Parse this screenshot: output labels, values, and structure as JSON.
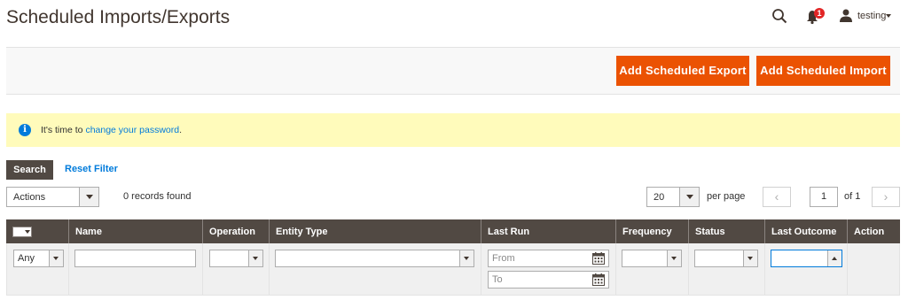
{
  "page": {
    "title": "Scheduled Imports/Exports"
  },
  "header": {
    "notifications_count": "1",
    "user_name": "testing"
  },
  "actions": {
    "add_export": "Add Scheduled Export",
    "add_import": "Add Scheduled Import"
  },
  "notice": {
    "prefix": "It's time to ",
    "link": "change your password",
    "suffix": "."
  },
  "grid_controls": {
    "search_label": "Search",
    "reset_label": "Reset Filter",
    "actions_select": "Actions",
    "records_found": "0 records found",
    "per_page_value": "20",
    "per_page_label": "per page",
    "page_current": "1",
    "page_total": "of 1",
    "prev_label": "‹",
    "next_label": "›"
  },
  "columns": {
    "name": "Name",
    "operation": "Operation",
    "entity_type": "Entity Type",
    "last_run": "Last Run",
    "frequency": "Frequency",
    "status": "Status",
    "last_outcome": "Last Outcome",
    "action": "Action"
  },
  "filters": {
    "massaction_value": "Any",
    "last_run_from_placeholder": "From",
    "last_run_to_placeholder": "To"
  },
  "colors": {
    "primary_button": "#eb5202",
    "grid_header": "#514943",
    "notice_bg": "#fffbbb",
    "link": "#007bdb"
  }
}
